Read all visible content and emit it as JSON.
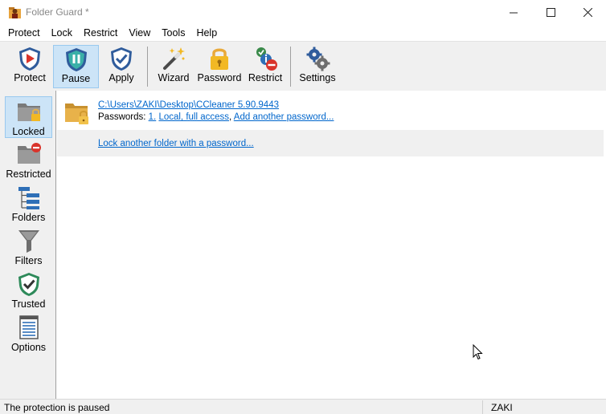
{
  "window": {
    "title": "Folder Guard *",
    "min_glyph": "—",
    "max_glyph": "☐",
    "close_glyph": "✕"
  },
  "menu": [
    "Protect",
    "Lock",
    "Restrict",
    "View",
    "Tools",
    "Help"
  ],
  "toolbar": {
    "protect": "Protect",
    "pause": "Pause",
    "apply": "Apply",
    "wizard": "Wizard",
    "password": "Password",
    "restrict": "Restrict",
    "settings": "Settings"
  },
  "nav": {
    "locked": "Locked",
    "restricted": "Restricted",
    "folders": "Folders",
    "filters": "Filters",
    "trusted": "Trusted",
    "options": "Options"
  },
  "content": {
    "entry_path": "C:\\Users\\ZAKI\\Desktop\\CCleaner 5.90.9443",
    "passwords_label": "Passwords: ",
    "password_number": "1.",
    "password_access": "Local, full access",
    "separator": ",",
    "add_password": "Add another password...",
    "lock_another": "Lock another folder with a password..."
  },
  "status": {
    "message": "The protection is paused",
    "user": "ZAKI"
  },
  "colors": {
    "accent": "#cce4f7",
    "link": "#0066cc",
    "folder": "#e8b24a"
  }
}
